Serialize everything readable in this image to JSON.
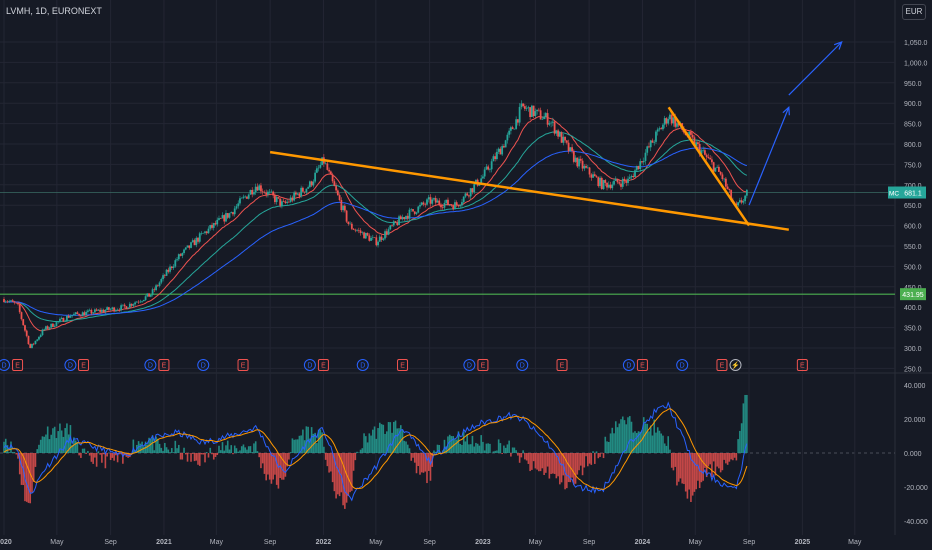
{
  "header": {
    "symbol_line": "LVMH, 1D, EURONEXT",
    "currency": "EUR"
  },
  "price_tag": {
    "ticker": "MC",
    "value": "681.1"
  },
  "support_tag": {
    "value": "431.95"
  },
  "colors": {
    "background": "#161a25",
    "grid": "#232633",
    "up": "#26a69a",
    "down": "#ef5350",
    "trendline": "#ff9800",
    "projection": "#2962ff",
    "support": "#4caf50",
    "ema_short": "#ef5350",
    "ema_mid": "#26a69a",
    "ema_long": "#2962ff"
  },
  "chart_data": [
    {
      "type": "candlestick",
      "title": "LVMH, 1D, EURONEXT",
      "y_unit": "EUR",
      "y_ticks": [
        "1,050.0",
        "1,000.0",
        "950.0",
        "900.0",
        "850.0",
        "800.0",
        "750.0",
        "700.0",
        "650.0",
        "600.0",
        "550.0",
        "500.0",
        "450.0",
        "400.0",
        "350.0",
        "300.0",
        "250.0"
      ],
      "y_range": [
        250,
        1080
      ],
      "x_ticks": [
        "2020",
        "May",
        "Sep",
        "2021",
        "May",
        "Sep",
        "2022",
        "May",
        "Sep",
        "2023",
        "May",
        "Sep",
        "2024",
        "May",
        "Sep",
        "2025",
        "May"
      ],
      "price_path": [
        [
          "2020-01",
          420
        ],
        [
          "2020-02",
          405
        ],
        [
          "2020-03",
          300
        ],
        [
          "2020-04",
          345
        ],
        [
          "2020-06",
          380
        ],
        [
          "2020-08",
          390
        ],
        [
          "2020-10",
          400
        ],
        [
          "2020-12",
          430
        ],
        [
          "2021-02",
          520
        ],
        [
          "2021-04",
          580
        ],
        [
          "2021-06",
          630
        ],
        [
          "2021-08",
          700
        ],
        [
          "2021-10",
          650
        ],
        [
          "2021-12",
          700
        ],
        [
          "2022-01",
          760
        ],
        [
          "2022-03",
          600
        ],
        [
          "2022-05",
          560
        ],
        [
          "2022-07",
          620
        ],
        [
          "2022-09",
          660
        ],
        [
          "2022-11",
          650
        ],
        [
          "2023-01",
          720
        ],
        [
          "2023-03",
          820
        ],
        [
          "2023-04",
          890
        ],
        [
          "2023-06",
          860
        ],
        [
          "2023-08",
          760
        ],
        [
          "2023-10",
          700
        ],
        [
          "2023-12",
          710
        ],
        [
          "2024-02",
          820
        ],
        [
          "2024-03",
          870
        ],
        [
          "2024-05",
          800
        ],
        [
          "2024-07",
          720
        ],
        [
          "2024-08",
          640
        ],
        [
          "2024-08-30",
          681
        ]
      ],
      "last_price": 681.1,
      "support_level": 431.95,
      "annotations": {
        "descending_trendline": [
          [
            "2021-09",
            780
          ],
          [
            "2024-12",
            590
          ]
        ],
        "short_trendline": [
          [
            "2024-03",
            890
          ],
          [
            "2024-09",
            600
          ]
        ],
        "projection_arrows": [
          [
            [
              "2024-09",
              650
            ],
            [
              "2024-12",
              890
            ]
          ],
          [
            [
              "2024-12",
              920
            ],
            [
              "2025-04",
              1050
            ]
          ]
        ]
      },
      "event_markers": [
        {
          "date": "2020-01",
          "label": "D"
        },
        {
          "date": "2020-02",
          "label": "E"
        },
        {
          "date": "2020-06",
          "label": "D"
        },
        {
          "date": "2020-07",
          "label": "E"
        },
        {
          "date": "2020-12",
          "label": "D"
        },
        {
          "date": "2021-01",
          "label": "E"
        },
        {
          "date": "2021-04",
          "label": "D"
        },
        {
          "date": "2021-07",
          "label": "E"
        },
        {
          "date": "2021-12",
          "label": "D"
        },
        {
          "date": "2022-01",
          "label": "E"
        },
        {
          "date": "2022-04",
          "label": "D"
        },
        {
          "date": "2022-07",
          "label": "E"
        },
        {
          "date": "2022-12",
          "label": "D"
        },
        {
          "date": "2023-01",
          "label": "E"
        },
        {
          "date": "2023-04",
          "label": "D"
        },
        {
          "date": "2023-07",
          "label": "E"
        },
        {
          "date": "2023-12",
          "label": "D"
        },
        {
          "date": "2024-01",
          "label": "E"
        },
        {
          "date": "2024-04",
          "label": "D"
        },
        {
          "date": "2024-07",
          "label": "E"
        },
        {
          "date": "2024-08",
          "label": "⚡"
        },
        {
          "date": "2025-01",
          "label": "E"
        }
      ]
    },
    {
      "type": "histogram",
      "y_ticks": [
        "40.000",
        "20.000",
        "0.000",
        "-20.000",
        "-40.000"
      ],
      "y_range": [
        -45,
        45
      ],
      "oscillator_path": [
        [
          "2020-01",
          5
        ],
        [
          "2020-02",
          2
        ],
        [
          "2020-03",
          -25
        ],
        [
          "2020-04",
          -10
        ],
        [
          "2020-06",
          8
        ],
        [
          "2020-08",
          3
        ],
        [
          "2020-10",
          -2
        ],
        [
          "2020-12",
          8
        ],
        [
          "2021-02",
          12
        ],
        [
          "2021-04",
          6
        ],
        [
          "2021-06",
          10
        ],
        [
          "2021-08",
          15
        ],
        [
          "2021-10",
          -12
        ],
        [
          "2021-12",
          8
        ],
        [
          "2022-01",
          14
        ],
        [
          "2022-03",
          -28
        ],
        [
          "2022-05",
          -8
        ],
        [
          "2022-07",
          15
        ],
        [
          "2022-09",
          -5
        ],
        [
          "2022-11",
          10
        ],
        [
          "2023-01",
          18
        ],
        [
          "2023-03",
          22
        ],
        [
          "2023-04",
          20
        ],
        [
          "2023-06",
          5
        ],
        [
          "2023-08",
          -20
        ],
        [
          "2023-10",
          -22
        ],
        [
          "2023-12",
          5
        ],
        [
          "2024-02",
          25
        ],
        [
          "2024-03",
          28
        ],
        [
          "2024-05",
          -8
        ],
        [
          "2024-07",
          -18
        ],
        [
          "2024-08",
          -22
        ],
        [
          "2024-08-30",
          8
        ]
      ]
    }
  ]
}
